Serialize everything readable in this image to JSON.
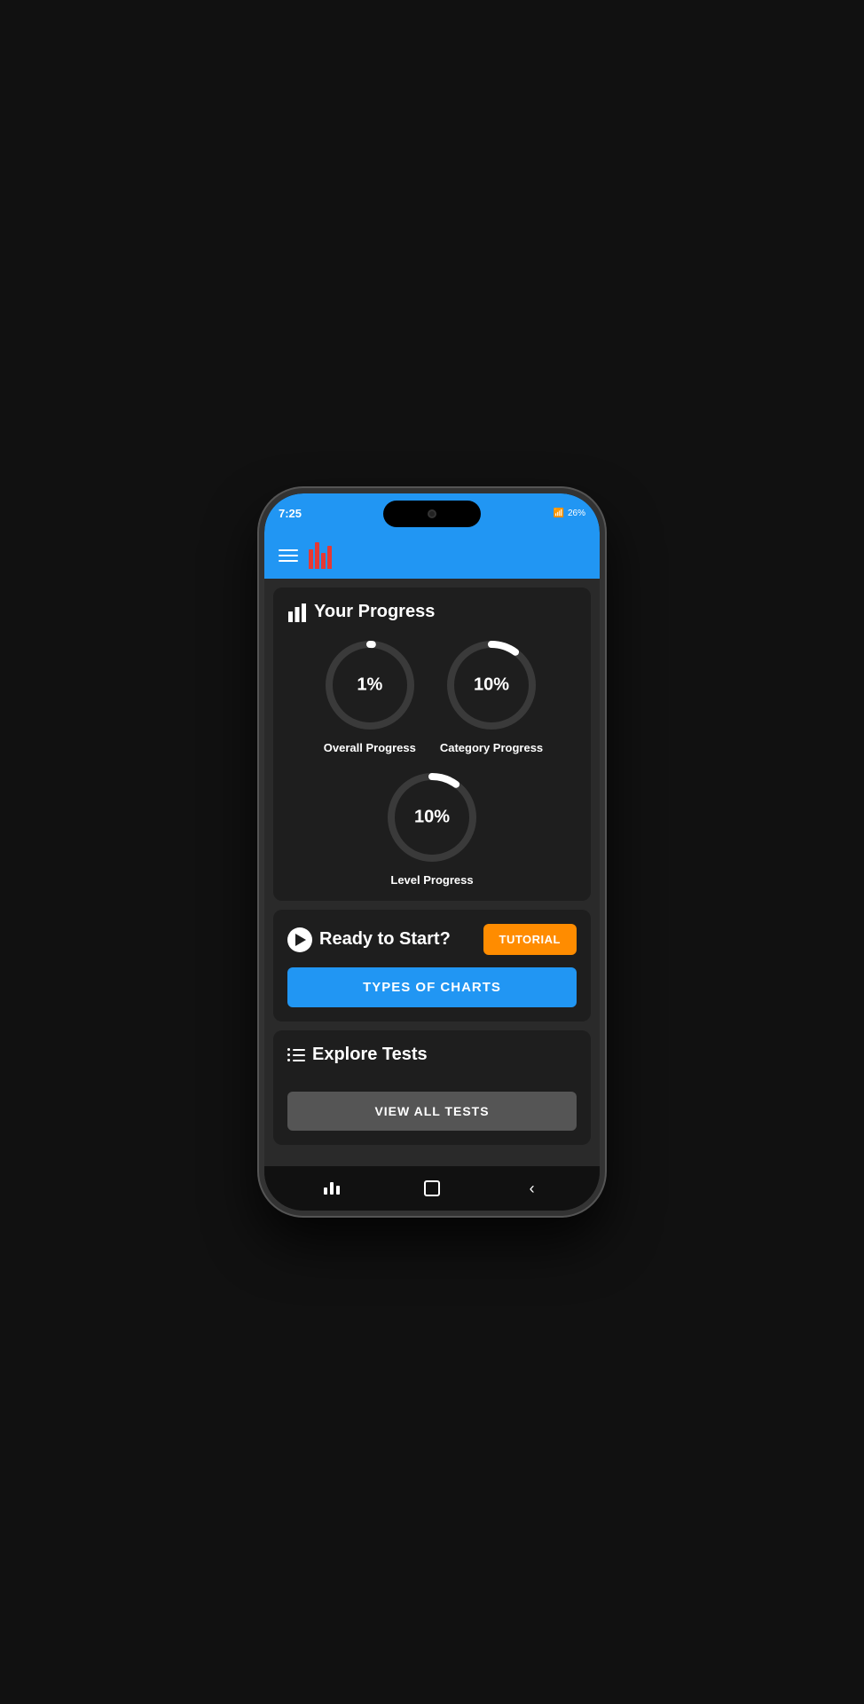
{
  "status_bar": {
    "time": "7:25",
    "battery": "26%",
    "signal": "LTE1 LTE2"
  },
  "header": {
    "menu_icon_label": "hamburger-menu",
    "logo_label": "app-logo"
  },
  "progress_card": {
    "title": "Your Progress",
    "overall": {
      "value": "1%",
      "label": "Overall Progress",
      "percent": 1
    },
    "category": {
      "value": "10%",
      "label": "Category Progress",
      "percent": 10
    },
    "level": {
      "value": "10%",
      "label": "Level Progress",
      "percent": 10
    }
  },
  "ready_card": {
    "title": "Ready to Start?",
    "tutorial_button": "TUTORIAL",
    "types_button": "TYPES OF CHARTS"
  },
  "explore_card": {
    "title": "Explore Tests",
    "view_all_button": "VIEW ALL TESTS"
  },
  "bottom_nav": {
    "bars_icon": "bars-icon",
    "square_icon": "square-icon",
    "back_icon": "back-icon"
  }
}
